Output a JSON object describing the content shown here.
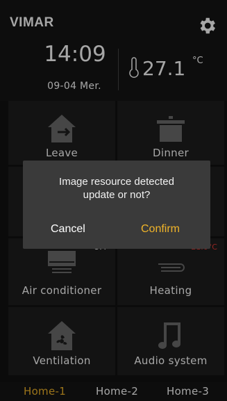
{
  "header": {
    "brand": "VIMAR",
    "time": "14:09",
    "date": "09-04 Mer.",
    "temperature": "27.1",
    "temperature_unit": "°C"
  },
  "tiles": [
    {
      "label": "Leave",
      "icon": "house-exit-icon"
    },
    {
      "label": "Dinner",
      "icon": "cooking-pot-icon"
    },
    {
      "label": "",
      "icon": ""
    },
    {
      "label": "",
      "icon": ""
    },
    {
      "label": "Air conditioner",
      "icon": "air-conditioner-icon",
      "status": "OFF"
    },
    {
      "label": "Heating",
      "icon": "radiator-icon",
      "status": "21.0°C"
    },
    {
      "label": "Ventilation",
      "icon": "fan-house-icon"
    },
    {
      "label": "Audio system",
      "icon": "music-note-icon"
    }
  ],
  "dialog": {
    "message_line1": "Image resource detected",
    "message_line2": "update or not?",
    "cancel_label": "Cancel",
    "confirm_label": "Confirm"
  },
  "tabs": [
    {
      "label": "Home-1",
      "active": true
    },
    {
      "label": "Home-2",
      "active": false
    },
    {
      "label": "Home-3",
      "active": false
    }
  ],
  "colors": {
    "accent": "#f0b429",
    "heating_status": "#e53935",
    "background": "#121212",
    "tile": "#1e1e1e",
    "dialog": "#3a3a3a"
  }
}
